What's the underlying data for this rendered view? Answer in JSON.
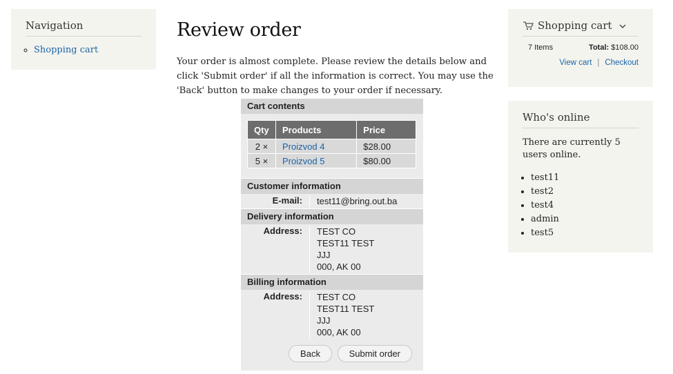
{
  "navigation": {
    "title": "Navigation",
    "items": [
      "Shopping cart"
    ]
  },
  "main": {
    "title": "Review order",
    "intro": "Your order is almost complete. Please review the details below and click 'Submit order' if all the information is correct. You may use the 'Back' button to make changes to your order if necessary."
  },
  "review": {
    "cart_heading": "Cart contents",
    "columns": [
      "Qty",
      "Products",
      "Price"
    ],
    "rows": [
      {
        "qty": "2 ×",
        "product": "Proizvod 4",
        "price": "$28.00"
      },
      {
        "qty": "5 ×",
        "product": "Proizvod 5",
        "price": "$80.00"
      }
    ],
    "customer_heading": "Customer information",
    "email_label": "E-mail:",
    "email": "test11@bring.out.ba",
    "delivery_heading": "Delivery information",
    "delivery_label": "Address:",
    "delivery_lines": [
      "TEST CO",
      "TEST11 TEST",
      "JJJ",
      "000, AK 00"
    ],
    "billing_heading": "Billing information",
    "billing_label": "Address:",
    "billing_lines": [
      "TEST CO",
      "TEST11 TEST",
      "JJJ",
      "000, AK 00"
    ],
    "back_label": "Back",
    "submit_label": "Submit order"
  },
  "cart_block": {
    "title": "Shopping cart",
    "items": "7 Items",
    "total_label": "Total:",
    "total": "$108.00",
    "view_cart": "View cart",
    "checkout": "Checkout"
  },
  "online": {
    "title": "Who's online",
    "text": "There are currently 5 users online.",
    "users": [
      "test11",
      "test2",
      "test4",
      "admin",
      "test5"
    ]
  }
}
